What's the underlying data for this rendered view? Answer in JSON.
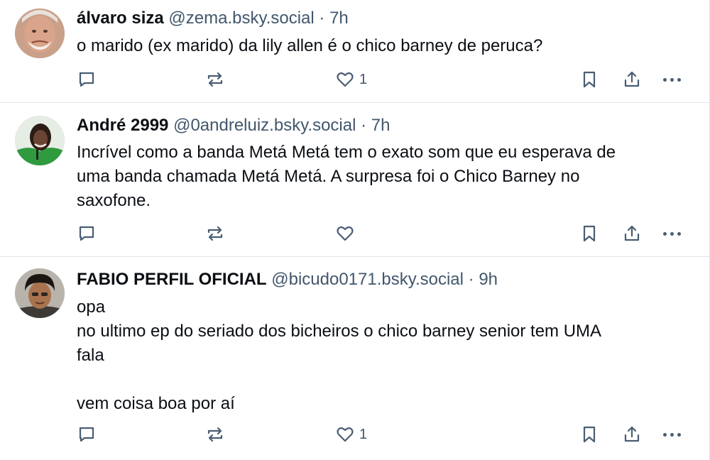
{
  "posts": [
    {
      "author": "álvaro siza",
      "handle": "@zema.bsky.social",
      "separator": "·",
      "time": "7h",
      "lines": [
        "o marido (ex marido) da lily allen é o chico barney de peruca?"
      ],
      "like_count": "1"
    },
    {
      "author": "André 2999",
      "handle": "@0andreluiz.bsky.social",
      "separator": "·",
      "time": "7h",
      "lines": [
        "Incrível como a banda Metá Metá tem o exato som que eu esperava de",
        "uma banda chamada Metá Metá. A surpresa foi o Chico Barney no",
        "saxofone."
      ],
      "like_count": ""
    },
    {
      "author": "FABIO PERFIL OFICIAL",
      "handle": "@bicudo0171.bsky.social",
      "separator": "·",
      "time": "9h",
      "lines": [
        "opa",
        "no ultimo ep do seriado dos bicheiros o chico barney senior tem UMA",
        "fala",
        "",
        "vem coisa boa por aí"
      ],
      "like_count": "1"
    }
  ],
  "icons": {
    "reply": "reply-icon",
    "repost": "repost-icon",
    "like": "heart-icon",
    "bookmark": "bookmark-icon",
    "share": "share-icon",
    "more": "more-icon"
  },
  "colors": {
    "text": "#0b0f14",
    "meta": "#42576c",
    "icon": "#4a5d72",
    "divider": "#dfe4ea"
  }
}
